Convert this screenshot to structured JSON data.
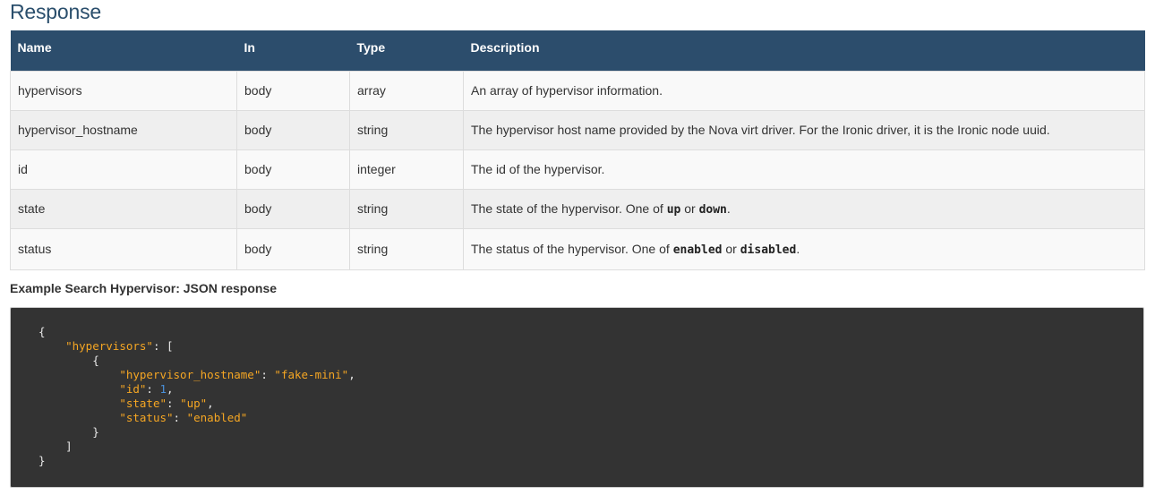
{
  "section": {
    "title": "Response"
  },
  "table": {
    "headers": [
      "Name",
      "In",
      "Type",
      "Description"
    ],
    "rows": [
      {
        "name": "hypervisors",
        "in": "body",
        "type": "array",
        "description": "An array of hypervisor information."
      },
      {
        "name": "hypervisor_hostname",
        "in": "body",
        "type": "string",
        "description": "The hypervisor host name provided by the Nova virt driver. For the Ironic driver, it is the Ironic node uuid."
      },
      {
        "name": "id",
        "in": "body",
        "type": "integer",
        "description": "The id of the hypervisor."
      },
      {
        "name": "state",
        "in": "body",
        "type": "string",
        "description_prefix": "The state of the hypervisor. One of ",
        "code1": "up",
        "description_mid": " or ",
        "code2": "down",
        "description_suffix": "."
      },
      {
        "name": "status",
        "in": "body",
        "type": "string",
        "description_prefix": "The status of the hypervisor. One of ",
        "code1": "enabled",
        "description_mid": " or ",
        "code2": "disabled",
        "description_suffix": "."
      }
    ]
  },
  "example": {
    "title": "Example Search Hypervisor: JSON response",
    "code": {
      "open_brace": "{",
      "key_hypervisors": "\"hypervisors\"",
      "open_bracket": "[",
      "inner_open": "{",
      "key_hostname": "\"hypervisor_hostname\"",
      "val_hostname": "\"fake-mini\"",
      "key_id": "\"id\"",
      "val_id": "1",
      "key_state": "\"state\"",
      "val_state": "\"up\"",
      "key_status": "\"status\"",
      "val_status": "\"enabled\"",
      "inner_close": "}",
      "close_bracket": "]",
      "close_brace": "}"
    }
  }
}
